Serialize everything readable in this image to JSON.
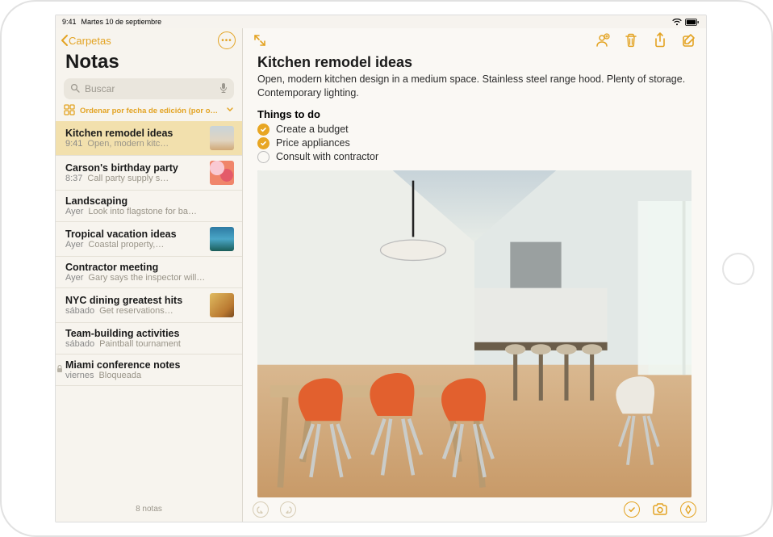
{
  "statusbar": {
    "time": "9:41",
    "date": "Martes 10 de septiembre"
  },
  "sidebar": {
    "back_label": "Carpetas",
    "title": "Notas",
    "search_placeholder": "Buscar",
    "sort_label": "Ordenar por fecha de edición (por omisión)",
    "footer": "8 notas",
    "notes": [
      {
        "title": "Kitchen remodel ideas",
        "time": "9:41",
        "preview": "Open, modern kitc…",
        "thumb": "th-kitchen",
        "selected": true,
        "locked": false
      },
      {
        "title": "Carson's birthday party",
        "time": "8:37",
        "preview": "Call party supply s…",
        "thumb": "th-party",
        "selected": false,
        "locked": false
      },
      {
        "title": "Landscaping",
        "time": "Ayer",
        "preview": "Look into flagstone for ba…",
        "thumb": "",
        "selected": false,
        "locked": false
      },
      {
        "title": "Tropical vacation ideas",
        "time": "Ayer",
        "preview": "Coastal property,…",
        "thumb": "th-tropical",
        "selected": false,
        "locked": false
      },
      {
        "title": "Contractor meeting",
        "time": "Ayer",
        "preview": "Gary says the inspector will…",
        "thumb": "",
        "selected": false,
        "locked": false
      },
      {
        "title": "NYC dining greatest hits",
        "time": "sábado",
        "preview": "Get reservations…",
        "thumb": "th-nyc",
        "selected": false,
        "locked": false
      },
      {
        "title": "Team-building activities",
        "time": "sábado",
        "preview": "Paintball tournament",
        "thumb": "",
        "selected": false,
        "locked": false
      },
      {
        "title": "Miami conference notes",
        "time": "viernes",
        "preview": "Bloqueada",
        "thumb": "",
        "selected": false,
        "locked": true
      }
    ]
  },
  "note": {
    "title": "Kitchen remodel ideas",
    "body": "Open, modern kitchen design in a medium space. Stainless steel range hood. Plenty of storage. Contemporary lighting.",
    "section": "Things to do",
    "items": [
      {
        "text": "Create a budget",
        "done": true
      },
      {
        "text": "Price appliances",
        "done": true
      },
      {
        "text": "Consult with contractor",
        "done": false
      }
    ]
  },
  "colors": {
    "accent": "#e3a322"
  }
}
